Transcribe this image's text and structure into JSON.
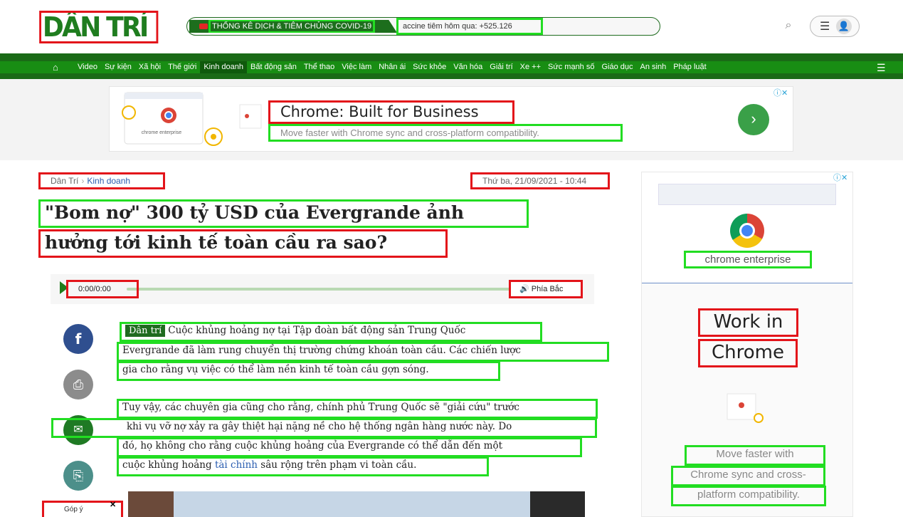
{
  "header": {
    "logo": "DÂN TRÍ",
    "ticker_label": "THỐNG KÊ DỊCH & TIÊM CHỦNG COVID-19",
    "ticker_vaccine": "accine tiêm hôm qua: +525.126"
  },
  "nav": {
    "items": [
      "Video",
      "Sự kiện",
      "Xã hội",
      "Thế giới",
      "Kinh doanh",
      "Bất động sản",
      "Thể thao",
      "Việc làm",
      "Nhân ái",
      "Sức khỏe",
      "Văn hóa",
      "Giải trí",
      "Xe ++",
      "Sức mạnh số",
      "Giáo dục",
      "An sinh",
      "Pháp luật"
    ],
    "active": "Kinh doanh"
  },
  "ad_top": {
    "headline": "Chrome: Built for Business",
    "subline": "Move faster with Chrome sync and cross-platform compatibility.",
    "brand": "chrome enterprise",
    "choices": "ⓘ✕"
  },
  "article": {
    "breadcrumb_home": "Dân Trí",
    "breadcrumb_section": "Kinh doanh",
    "datetime": "Thứ ba, 21/09/2021 - 10:44",
    "title_line1": "\"Bom nợ\" 300 tỷ USD của Evergrande ảnh",
    "title_line2": "hưởng tới kinh tế toàn cầu ra sao?",
    "audio_time": "0:00/0:00",
    "audio_voice": "Phía Bắc",
    "tag": "Dân trí",
    "p1_line1": "Cuộc khủng hoảng nợ tại Tập đoàn bất động sản Trung Quốc",
    "p1_line2": "Evergrande đã làm rung chuyển thị trường chứng khoán toàn cầu. Các chiến lược",
    "p1_line3": "gia cho rằng vụ việc có thể làm nền kinh tế toàn cầu gợn sóng.",
    "p2_line1": "Tuy vậy, các chuyên gia cũng cho rằng, chính phủ Trung Quốc sẽ \"giải cứu\" trước",
    "p2_line2": "khi vụ vỡ nợ xảy ra gây thiệt hại nặng nề cho hệ thống ngân hàng nước này. Do",
    "p2_line3": "đó, họ không cho rằng cuộc khủng hoảng của Evergrande có thể dẫn đến một",
    "p2_line4_pre": "cuộc khủng hoảng ",
    "p2_line4_link": "tài chính",
    "p2_line4_post": " sâu rộng trên phạm vi toàn cầu.",
    "suggest": "Góp ý"
  },
  "ad_right": {
    "brand": "chrome enterprise",
    "headline1": "Work in",
    "headline2": "Chrome",
    "sub1": "Move faster with",
    "sub2": "Chrome sync and cross-",
    "sub3": "platform compatibility.",
    "choices": "ⓘ✕"
  },
  "colors": {
    "brand_green": "#1a6a16",
    "link_blue": "#2a5db0",
    "facebook": "#2f4f8f"
  }
}
